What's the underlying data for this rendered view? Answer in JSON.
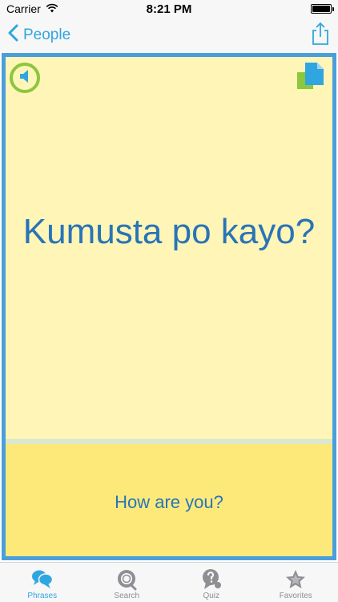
{
  "status_bar": {
    "carrier": "Carrier",
    "time": "8:21 PM",
    "battery_level": 1.0
  },
  "nav": {
    "back_label": "People",
    "back_icon": "chevron-left-icon",
    "share_icon": "share-icon"
  },
  "card": {
    "phrase": "Kumusta po kayo?",
    "translation": "How are you?",
    "speaker_icon": "speaker-icon",
    "copy_icon": "copy-icon"
  },
  "tabs": [
    {
      "label": "Phrases",
      "icon": "speech-bubbles-icon",
      "active": true
    },
    {
      "label": "Search",
      "icon": "search-icon",
      "active": false
    },
    {
      "label": "Quiz",
      "icon": "quiz-icon",
      "active": false
    },
    {
      "label": "Favorites",
      "icon": "star-icon",
      "active": false
    }
  ],
  "colors": {
    "accent": "#2fa6e0",
    "card_border": "#4a9fdb",
    "card_top_bg": "#fef5b6",
    "card_bottom_bg": "#fde97a",
    "text_blue": "#2874b8",
    "speaker_ring": "#8dc63f"
  }
}
